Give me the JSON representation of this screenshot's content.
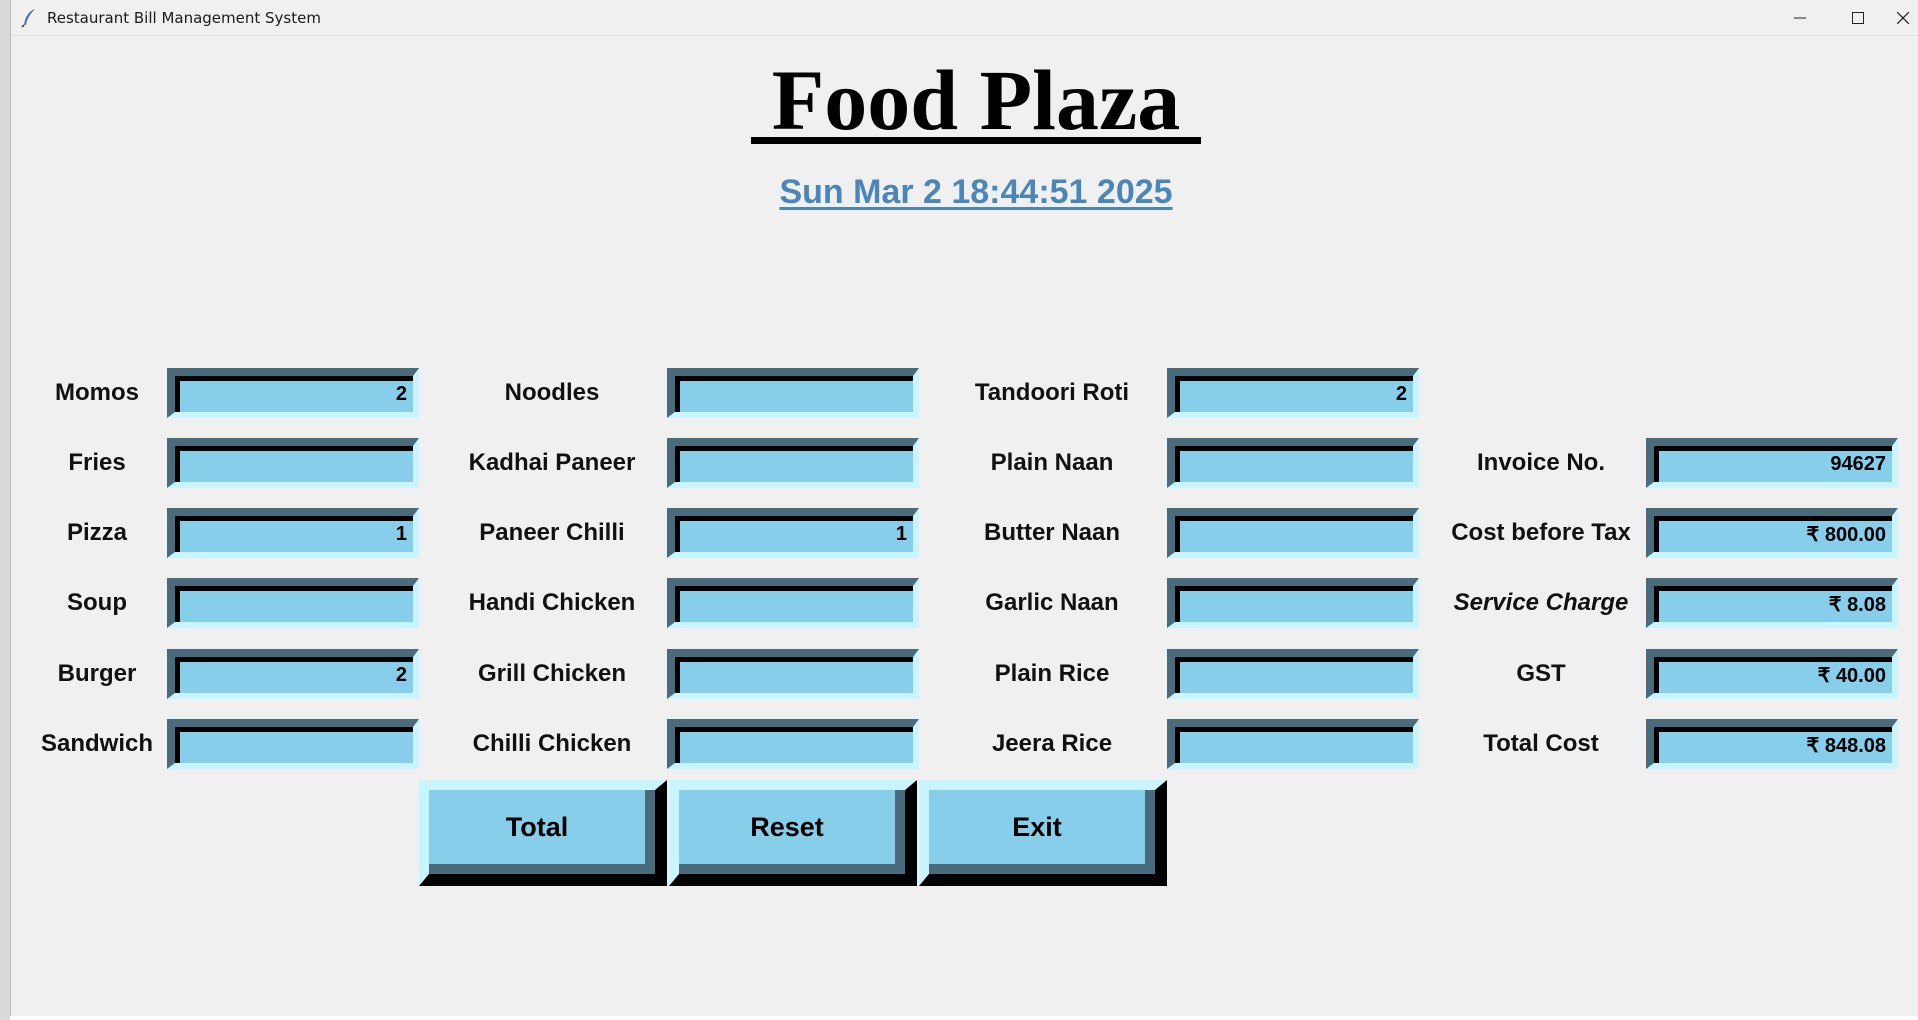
{
  "window": {
    "title": "Restaurant Bill Management System",
    "controls": [
      "minimize-icon",
      "maximize-icon",
      "close-icon"
    ]
  },
  "header": {
    "heading": "Food Plaza",
    "datetime": "Sun Mar  2 18:44:51 2025"
  },
  "colors": {
    "entry_bg": "#87ceeb",
    "button_bg": "#87ceeb",
    "clock_text": "#4a86b8"
  },
  "menu": {
    "col1": [
      {
        "label": "Momos",
        "value": "2"
      },
      {
        "label": "Fries",
        "value": ""
      },
      {
        "label": "Pizza",
        "value": "1"
      },
      {
        "label": "Soup",
        "value": ""
      },
      {
        "label": "Burger",
        "value": "2"
      },
      {
        "label": "Sandwich",
        "value": ""
      }
    ],
    "col2": [
      {
        "label": "Noodles",
        "value": ""
      },
      {
        "label": "Kadhai Paneer",
        "value": ""
      },
      {
        "label": "Paneer Chilli",
        "value": "1"
      },
      {
        "label": "Handi Chicken",
        "value": ""
      },
      {
        "label": "Grill Chicken",
        "value": ""
      },
      {
        "label": "Chilli Chicken",
        "value": ""
      }
    ],
    "col3": [
      {
        "label": "Tandoori Roti",
        "value": "2"
      },
      {
        "label": "Plain Naan",
        "value": ""
      },
      {
        "label": "Butter Naan",
        "value": ""
      },
      {
        "label": "Garlic Naan",
        "value": ""
      },
      {
        "label": "Plain Rice",
        "value": ""
      },
      {
        "label": "Jeera Rice",
        "value": ""
      }
    ]
  },
  "billing": [
    {
      "label": "Invoice No.",
      "value": "94627"
    },
    {
      "label": "Cost before Tax",
      "value": "₹ 800.00"
    },
    {
      "label": "Service Charge",
      "value": "₹ 8.08"
    },
    {
      "label": "GST",
      "value": "₹ 40.00"
    },
    {
      "label": "Total Cost",
      "value": "₹ 848.08"
    }
  ],
  "buttons": {
    "total": "Total",
    "reset": "Reset",
    "exit": "Exit"
  }
}
